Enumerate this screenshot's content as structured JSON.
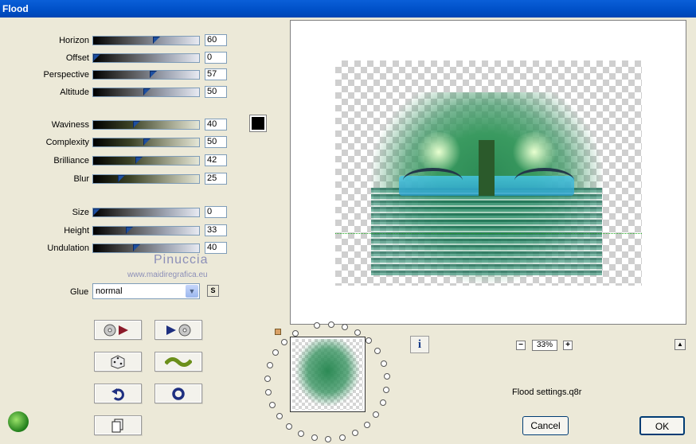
{
  "window": {
    "title": "Flood"
  },
  "sliders": [
    {
      "label": "Horizon",
      "value": "60",
      "level": 0.6,
      "group": "a"
    },
    {
      "label": "Offset",
      "value": "0",
      "level": 0.0,
      "group": "a"
    },
    {
      "label": "Perspective",
      "value": "57",
      "level": 0.57,
      "group": "a"
    },
    {
      "label": "Altitude",
      "value": "50",
      "level": 0.5,
      "group": "a"
    },
    {
      "label": "Waviness",
      "value": "40",
      "level": 0.4,
      "group": "b"
    },
    {
      "label": "Complexity",
      "value": "50",
      "level": 0.5,
      "group": "b"
    },
    {
      "label": "Brilliance",
      "value": "42",
      "level": 0.42,
      "group": "b"
    },
    {
      "label": "Blur",
      "value": "25",
      "level": 0.25,
      "group": "b"
    },
    {
      "label": "Size",
      "value": "0",
      "level": 0.0,
      "group": "a"
    },
    {
      "label": "Height",
      "value": "33",
      "level": 0.33,
      "group": "a"
    },
    {
      "label": "Undulation",
      "value": "40",
      "level": 0.4,
      "group": "a"
    }
  ],
  "color_swatch": "#000000",
  "watermark": {
    "name": "Pinuccia",
    "url": "www.maidiregrafica.eu"
  },
  "glue": {
    "label": "Glue",
    "selected": "normal",
    "button_label": "S"
  },
  "tool_buttons": [
    {
      "name": "load-preset-icon"
    },
    {
      "name": "save-preset-icon"
    },
    {
      "name": "randomize-dice-icon"
    },
    {
      "name": "wave-icon"
    },
    {
      "name": "undo-icon"
    },
    {
      "name": "reset-ring-icon"
    },
    {
      "name": "copy-page-icon"
    }
  ],
  "info_label": "i",
  "zoom": {
    "minus": "−",
    "value": "33%",
    "plus": "+"
  },
  "scroll_up": "▲",
  "settings_file": "Flood settings.q8r",
  "buttons": {
    "cancel": "Cancel",
    "ok": "OK"
  },
  "colors": {
    "titlebar": "#0050c8",
    "dialog_bg": "#ece9d8",
    "accent": "#1d4fa0"
  }
}
